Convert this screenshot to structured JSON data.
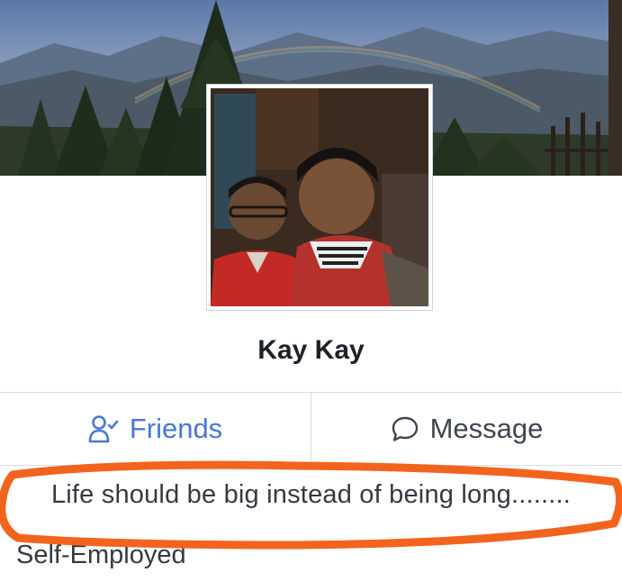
{
  "profile": {
    "name": "Kay Kay",
    "bio": "Life should be big instead of being long........",
    "work": "Self-Employed"
  },
  "actions": {
    "friends_label": "Friends",
    "message_label": "Message"
  },
  "icons": {
    "friends": "friends-check-icon",
    "message": "speech-bubble-icon"
  },
  "colors": {
    "friends_accent": "#4a76d8",
    "highlight_stroke": "#f2641e",
    "text": "#353a42"
  }
}
